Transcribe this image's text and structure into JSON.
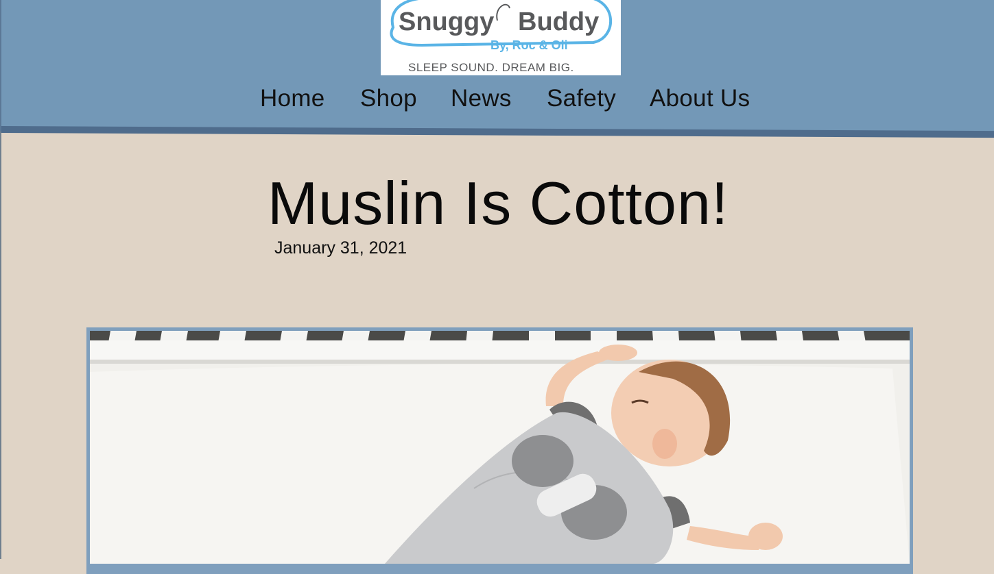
{
  "brand": {
    "name_part1": "Snuggy",
    "name_part2": "Buddy",
    "byline": "By, Roc & Oli",
    "tagline": "SLEEP SOUND. DREAM BIG."
  },
  "nav": {
    "items": [
      {
        "label": "Home"
      },
      {
        "label": "Shop"
      },
      {
        "label": "News"
      },
      {
        "label": "Safety"
      },
      {
        "label": "About Us"
      }
    ]
  },
  "article": {
    "title": "Muslin Is Cotton!",
    "date": "January 31, 2021"
  },
  "colors": {
    "header_bg": "#7398b7",
    "page_bg": "#e0d4c6",
    "logo_blue": "#5ab4e6",
    "logo_text": "#58595b"
  }
}
